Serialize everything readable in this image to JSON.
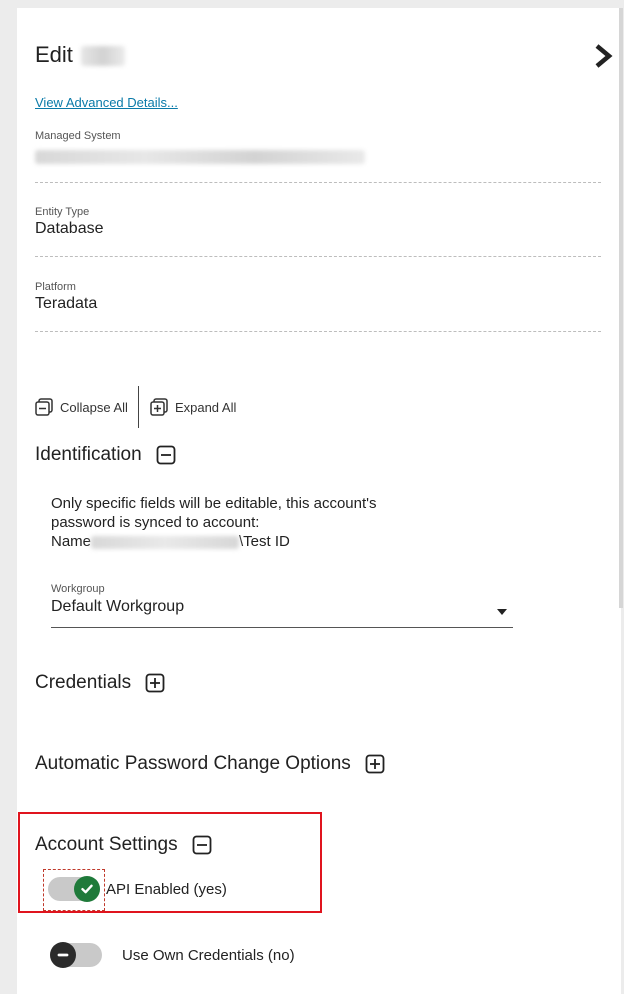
{
  "header": {
    "title": "Edit",
    "view_advanced": "View Advanced Details..."
  },
  "fields": {
    "managed_system": {
      "label": "Managed System",
      "value": ""
    },
    "entity_type": {
      "label": "Entity Type",
      "value": "Database"
    },
    "platform": {
      "label": "Platform",
      "value": "Teradata"
    }
  },
  "controls": {
    "collapse_all": "Collapse All",
    "expand_all": "Expand All"
  },
  "sections": {
    "identification": {
      "title": "Identification",
      "info_line1": "Only specific fields will be editable, this account's",
      "info_line2": "password is synced to account:",
      "info_name_prefix": "Name",
      "info_name_suffix": "\\Test ID",
      "workgroup_label": "Workgroup",
      "workgroup_value": "Default Workgroup"
    },
    "credentials": {
      "title": "Credentials"
    },
    "auto_password": {
      "title": "Automatic Password Change Options"
    },
    "account_settings": {
      "title": "Account Settings",
      "api_enabled_label": "API Enabled (yes)",
      "use_own_credentials_label": "Use Own Credentials (no)"
    }
  },
  "icons": {
    "panel_toggle": "chevron-right-icon",
    "collapse_all": "collapse-all-icon",
    "expand_all": "expand-all-icon",
    "collapse_section": "minus-box-icon",
    "expand_section": "plus-box-icon",
    "toggle_on": "check-circle-icon",
    "toggle_off": "minus-circle-icon"
  },
  "colors": {
    "link": "#0a7aa8",
    "toggle_on": "#1f7a3a",
    "toggle_off": "#2b2b2b",
    "highlight": "#e0141e"
  },
  "toggles": {
    "api_enabled": true,
    "use_own_credentials": false
  }
}
